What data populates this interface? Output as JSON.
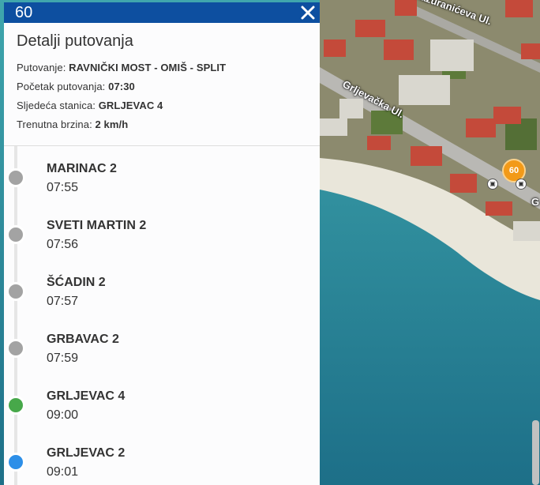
{
  "panel": {
    "route_number": "60",
    "title": "Detalji putovanja",
    "trip_label": "Putovanje:",
    "trip_value": "RAVNIČKI MOST - OMIŠ - SPLIT",
    "start_label": "Početak putovanja:",
    "start_value": "07:30",
    "next_label": "Sljedeća stanica:",
    "next_value": "GRLJEVAC 4",
    "speed_label": "Trenutna brzina:",
    "speed_value": "2 km/h"
  },
  "stops": [
    {
      "name": "MARINAC 2",
      "time": "07:55",
      "status": "passed"
    },
    {
      "name": "SVETI MARTIN 2",
      "time": "07:56",
      "status": "passed"
    },
    {
      "name": "ŠĆADIN 2",
      "time": "07:57",
      "status": "passed"
    },
    {
      "name": "GRBAVAC 2",
      "time": "07:59",
      "status": "passed"
    },
    {
      "name": "GRLJEVAC 4",
      "time": "09:00",
      "status": "next"
    },
    {
      "name": "GRLJEVAC 2",
      "time": "09:01",
      "status": "upcoming"
    }
  ],
  "colors": {
    "passed": "#a3a3a3",
    "next": "#47a84a",
    "upcoming": "#2d8fe8",
    "header": "#0d4fa0",
    "bus_marker": "#f29a18"
  },
  "map": {
    "bus_label": "60",
    "streets": [
      "Mažuranićeva Ul.",
      "Grljevačka Ul.",
      "G"
    ],
    "stop_icon": "bus-stop-icon"
  }
}
